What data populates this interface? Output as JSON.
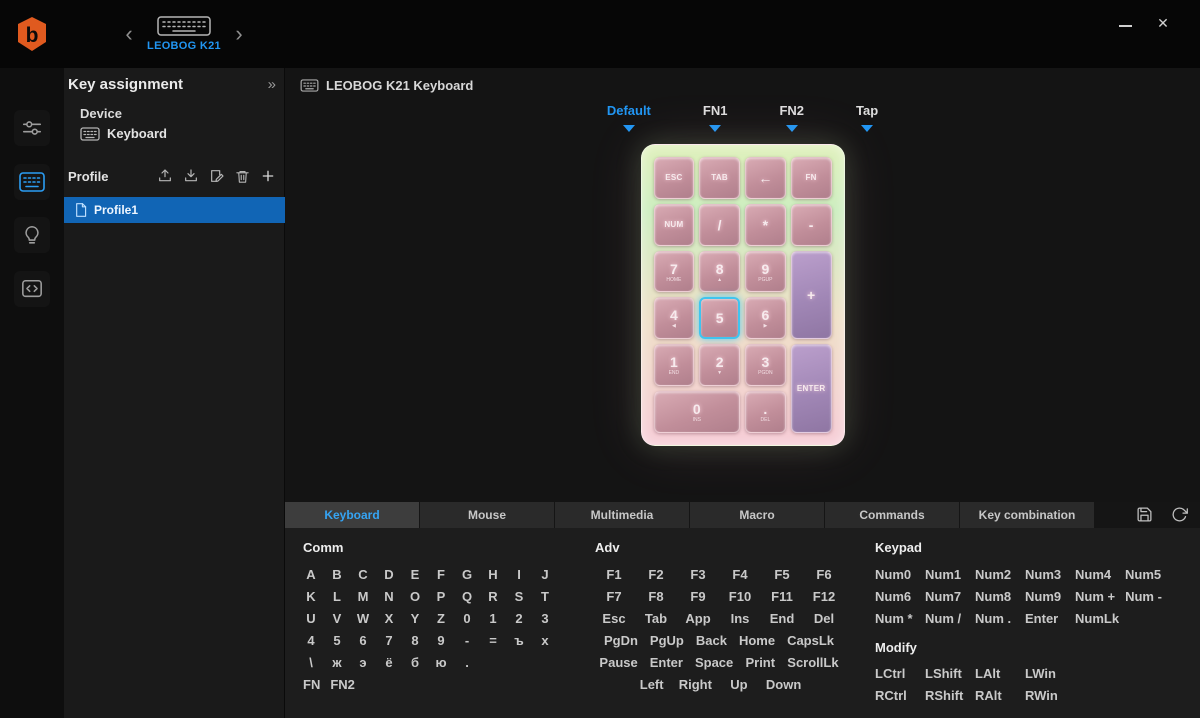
{
  "accent": "#2196f3",
  "titlebar": {
    "device_switcher": {
      "label": "LEOBOG K21",
      "prev": "‹",
      "next": "›"
    },
    "window": {
      "close": "✕"
    }
  },
  "nav": {
    "items": [
      {
        "icon": "sliders"
      },
      {
        "icon": "keyboard",
        "active": true
      },
      {
        "icon": "lightbulb"
      },
      {
        "icon": "code"
      }
    ]
  },
  "panel": {
    "title": "Key assignment",
    "collapse": "»",
    "device_label": "Device",
    "device_name": "Keyboard",
    "profile": {
      "label": "Profile",
      "items": [
        {
          "name": "Profile1",
          "selected": true
        }
      ]
    }
  },
  "main": {
    "header": "LEOBOG K21 Keyboard",
    "layers": [
      {
        "label": "Default",
        "active": true
      },
      {
        "label": "FN1"
      },
      {
        "label": "FN2"
      },
      {
        "label": "Tap"
      }
    ],
    "numpad": {
      "keys": [
        {
          "id": "esc",
          "label": "ESC"
        },
        {
          "id": "tab",
          "label": "TAB"
        },
        {
          "id": "backspace",
          "label": "←"
        },
        {
          "id": "fn",
          "label": "FN"
        },
        {
          "id": "num",
          "label": "NUM"
        },
        {
          "id": "slash",
          "label": "/"
        },
        {
          "id": "star",
          "label": "*"
        },
        {
          "id": "minus",
          "label": "-"
        },
        {
          "id": "k7",
          "label": "7",
          "sub": "HOME"
        },
        {
          "id": "k8",
          "label": "8",
          "sub": "▲"
        },
        {
          "id": "k9",
          "label": "9",
          "sub": "PGUP"
        },
        {
          "id": "plus",
          "label": "+"
        },
        {
          "id": "k4",
          "label": "4",
          "sub": "◀"
        },
        {
          "id": "k5",
          "label": "5",
          "selected": true
        },
        {
          "id": "k6",
          "label": "6",
          "sub": "▶"
        },
        {
          "id": "k1",
          "label": "1",
          "sub": "END"
        },
        {
          "id": "k2",
          "label": "2",
          "sub": "▼"
        },
        {
          "id": "k3",
          "label": "3",
          "sub": "PGDN"
        },
        {
          "id": "enter",
          "label": "ENTER"
        },
        {
          "id": "k0",
          "label": "0",
          "sub": "INS"
        },
        {
          "id": "dot",
          "label": ".",
          "sub": "DEL"
        }
      ]
    }
  },
  "bottom": {
    "tabs": [
      {
        "label": "Keyboard",
        "active": true
      },
      {
        "label": "Mouse"
      },
      {
        "label": "Multimedia"
      },
      {
        "label": "Macro"
      },
      {
        "label": "Commands"
      },
      {
        "label": "Key combination"
      }
    ],
    "sections": {
      "comm": {
        "title": "Comm",
        "rows": [
          [
            "A",
            "B",
            "C",
            "D",
            "E",
            "F",
            "G",
            "H",
            "I",
            "J"
          ],
          [
            "K",
            "L",
            "M",
            "N",
            "O",
            "P",
            "Q",
            "R",
            "S",
            "T"
          ],
          [
            "U",
            "V",
            "W",
            "X",
            "Y",
            "Z",
            "0",
            "1",
            "2",
            "3"
          ],
          [
            "4",
            "5",
            "6",
            "7",
            "8",
            "9",
            "-",
            "=",
            "ъ",
            "х"
          ],
          [
            "\\",
            "ж",
            "э",
            "ё",
            "б",
            "ю",
            "."
          ],
          [
            "FN",
            "FN2"
          ]
        ]
      },
      "adv": {
        "title": "Adv",
        "rows": [
          [
            "F1",
            "F2",
            "F3",
            "F4",
            "F5",
            "F6"
          ],
          [
            "F7",
            "F8",
            "F9",
            "F10",
            "F11",
            "F12"
          ],
          [
            "Esc",
            "Tab",
            "App",
            "Ins",
            "End",
            "Del"
          ],
          [
            "PgDn",
            "PgUp",
            "Back",
            "Home",
            "CapsLk"
          ],
          [
            "Pause",
            "Enter",
            "Space",
            "Print",
            "ScrollLk"
          ],
          [
            "Left",
            "Right",
            "Up",
            "Down"
          ]
        ]
      },
      "keypad": {
        "title": "Keypad",
        "rows": [
          [
            "Num0",
            "Num1",
            "Num2",
            "Num3",
            "Num4",
            "Num5"
          ],
          [
            "Num6",
            "Num7",
            "Num8",
            "Num9",
            "Num +",
            "Num -"
          ],
          [
            "Num *",
            "Num /",
            "Num .",
            "Enter",
            "NumLk"
          ]
        ]
      },
      "modify": {
        "title": "Modify",
        "rows": [
          [
            "LCtrl",
            "LShift",
            "LAlt",
            "LWin"
          ],
          [
            "RCtrl",
            "RShift",
            "RAlt",
            "RWin"
          ]
        ]
      }
    }
  }
}
